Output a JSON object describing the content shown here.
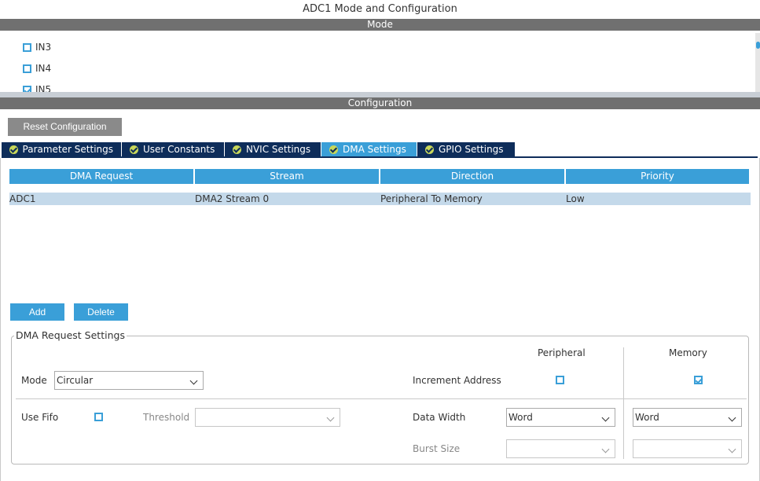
{
  "window": {
    "title": "ADC1 Mode and Configuration"
  },
  "mode_section": {
    "header": "Mode",
    "channels": [
      {
        "label": "IN3",
        "checked": false
      },
      {
        "label": "IN4",
        "checked": false
      },
      {
        "label": "IN5",
        "checked": true
      }
    ]
  },
  "config_section": {
    "header": "Configuration",
    "reset_label": "Reset Configuration",
    "tabs": [
      {
        "label": "Parameter Settings",
        "active": false
      },
      {
        "label": "User Constants",
        "active": false
      },
      {
        "label": "NVIC Settings",
        "active": false
      },
      {
        "label": "DMA Settings",
        "active": true
      },
      {
        "label": "GPIO Settings",
        "active": false
      }
    ]
  },
  "dma_table": {
    "headers": [
      "DMA Request",
      "Stream",
      "Direction",
      "Priority"
    ],
    "rows": [
      [
        "ADC1",
        "DMA2 Stream 0",
        "Peripheral To Memory",
        "Low"
      ]
    ]
  },
  "buttons": {
    "add": "Add",
    "delete": "Delete"
  },
  "request_settings": {
    "legend": "DMA Request Settings",
    "mode_label": "Mode",
    "mode_value": "Circular",
    "use_fifo_label": "Use Fifo",
    "use_fifo_checked": false,
    "threshold_label": "Threshold",
    "threshold_value": "",
    "peripheral_header": "Peripheral",
    "memory_header": "Memory",
    "increment_address_label": "Increment Address",
    "increment_peripheral_checked": false,
    "increment_memory_checked": true,
    "data_width_label": "Data Width",
    "data_width_peripheral": "Word",
    "data_width_memory": "Word",
    "burst_size_label": "Burst Size",
    "burst_size_peripheral": "",
    "burst_size_memory": ""
  },
  "colors": {
    "accent": "#3a9fd8",
    "navy": "#0e2d5a",
    "section_bar": "#707070",
    "row_selected": "#c4d9ea"
  }
}
